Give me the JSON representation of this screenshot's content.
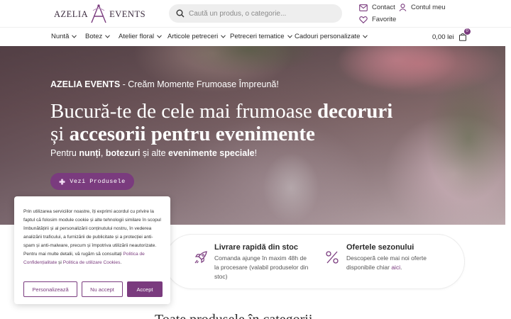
{
  "header": {
    "logo_left": "AZELIA",
    "logo_right": "EVENTS",
    "search_placeholder": "Caută un produs, o categorie...",
    "contact_label": "Contact",
    "account_label": "Contul meu",
    "favorites_label": "Favorite"
  },
  "nav": {
    "items": [
      {
        "label": "Nuntă"
      },
      {
        "label": "Botez"
      },
      {
        "label": "Atelier floral"
      },
      {
        "label": "Articole petreceri"
      },
      {
        "label": "Petreceri tematice"
      },
      {
        "label": "Cadouri personalizate"
      }
    ],
    "cart_total": "0,00 lei",
    "cart_count": "0"
  },
  "hero": {
    "kicker_brand": "AZELIA EVENTS",
    "kicker_rest": " - Creăm Momente Frumoase Împreună!",
    "title_part1": "Bucură-te de cele mai frumoase ",
    "title_bold1": "decoruri",
    "title_part2": "și ",
    "title_bold2": "accesorii pentru evenimente",
    "sub_part1": "Pentru ",
    "sub_bold1": "nunți",
    "sub_part2": ", ",
    "sub_bold2": "botezuri",
    "sub_part3": " și alte ",
    "sub_bold3": "evenimente speciale",
    "sub_part4": "!",
    "button_label": "Vezi Produsele"
  },
  "features": [
    {
      "title": "Livrare rapidă din stoc",
      "text": "Comanda ajunge în maxim 48h de la procesare (valabil produselor din stoc)",
      "icon": "rocket-icon"
    },
    {
      "title": "Ofertele sezonului",
      "text_before": "Descoperă cele mai noi oferte disponibile chiar ",
      "link": "aici",
      "text_after": ".",
      "icon": "percent-icon"
    }
  ],
  "bottom_heading": "Toate produsele în categorii",
  "cookie": {
    "text": "Prin utilizarea serviciilor noastre, îți exprimi acordul cu privire la faptul că folosim module cookie și alte tehnologii similare în scopul îmbunătățirii și al personalizării conținutului nostru, în vederea analizării traficului, a furnizării de publicitate și a protecției anti-spam și anti-malware, precum și împotriva utilizării neautorizate. Pentru mai multe detalii, vă rugăm să consultați ",
    "link_privacy": "Politica de Confidențialitate",
    "and": " și ",
    "link_cookies": "Politica de utilizare Cookies",
    "end": ".",
    "btn_customize": "Personalizează",
    "btn_reject": "Nu accept",
    "btn_accept": "Accept"
  },
  "colors": {
    "accent": "#7a3b7e"
  }
}
